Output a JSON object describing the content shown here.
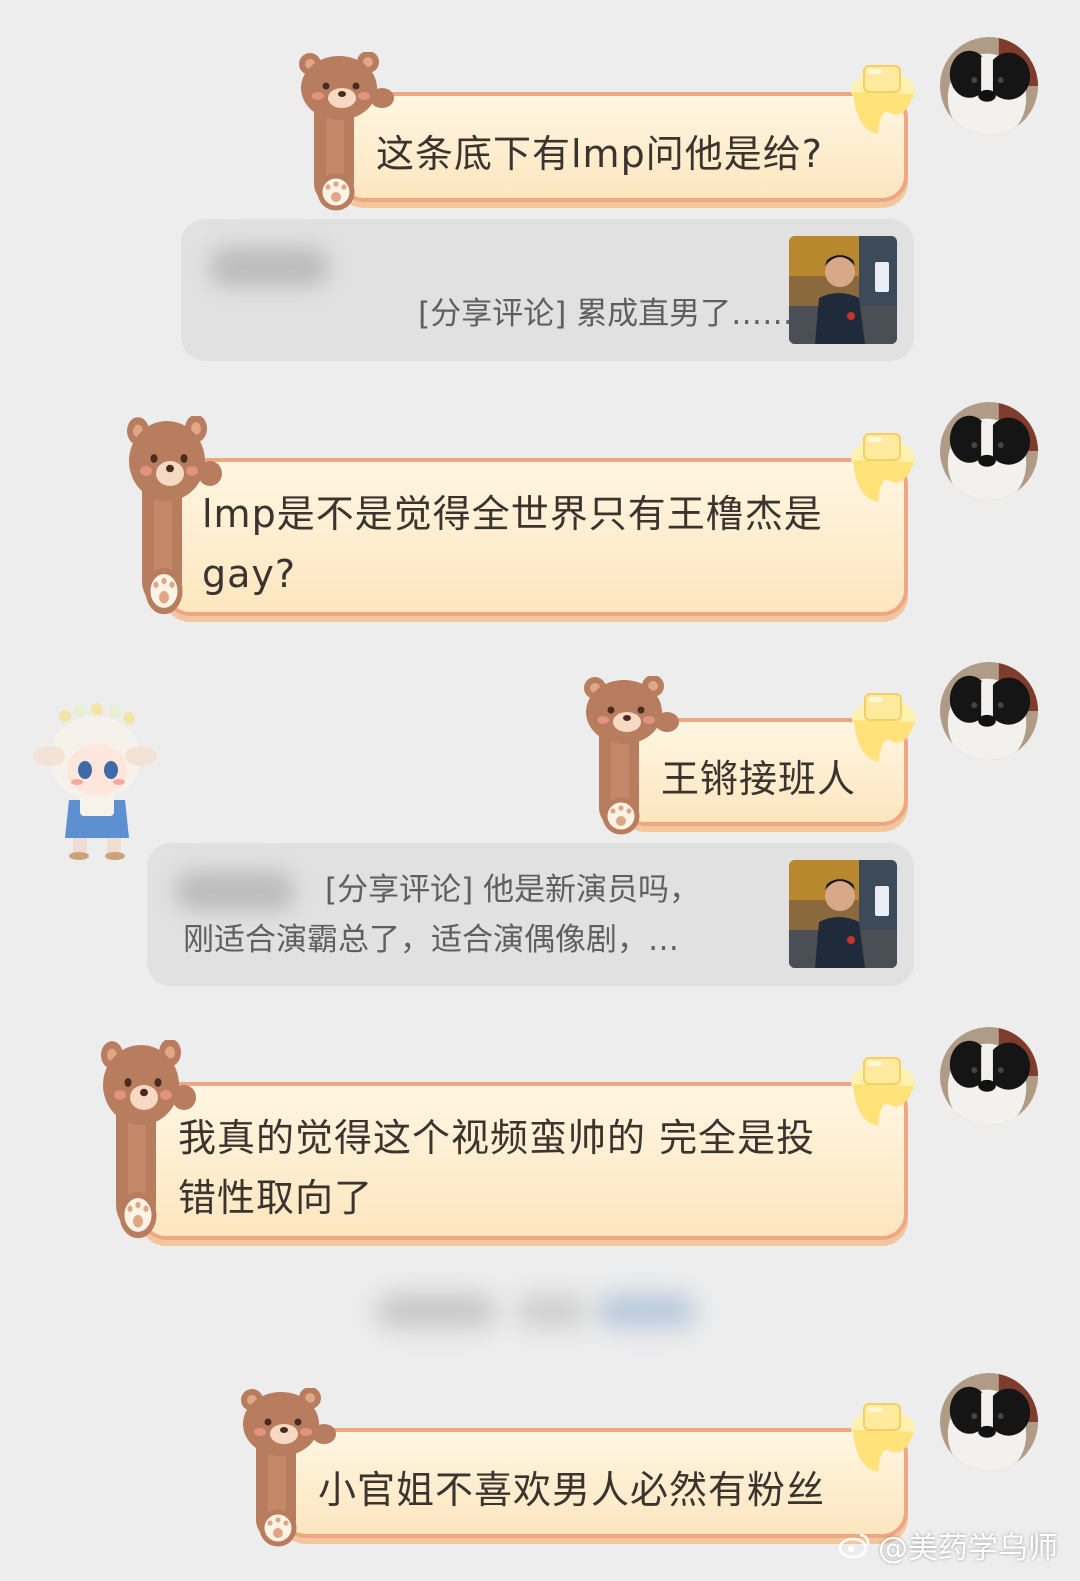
{
  "messages": [
    {
      "text": "这条底下有lmp问他是给?"
    },
    {
      "label": "[分享评论]",
      "body": "累成直男了……"
    },
    {
      "text": "lmp是不是觉得全世界只有王橹杰是\ngay?"
    },
    {
      "text": "王锵接班人"
    },
    {
      "label": "[分享评论]",
      "body": "他是新演员吗，\n刚适合演霸总了，适合演偶像剧，…"
    },
    {
      "text": "我真的觉得这个视频蛮帅的 完全是投\n错性取向了"
    },
    {
      "text": "小官姐不喜欢男人必然有粉丝"
    }
  ],
  "watermark": {
    "text": "@美药学乌师"
  },
  "icons": {
    "bear": "bear-sticker-icon",
    "butter": "butter-icon",
    "weibo": "weibo-logo-icon"
  },
  "colors": {
    "background": "#ededed",
    "bubble_border": "#eda783",
    "bubble_fill": "#fdebc9",
    "card": "#e1e1e1",
    "bear": "#b77d5e"
  }
}
